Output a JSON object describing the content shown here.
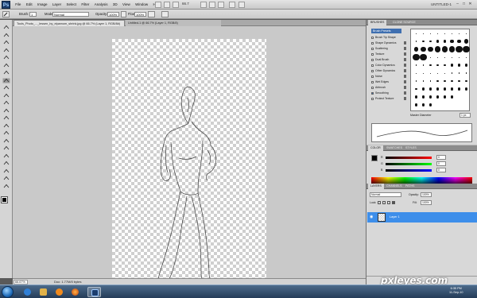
{
  "app": {
    "logo": "Ps",
    "menus": [
      "File",
      "Edit",
      "Image",
      "Layer",
      "Select",
      "Filter",
      "Analysis",
      "3D",
      "View",
      "Window",
      "Help"
    ],
    "zoom_menu": "66.7",
    "workspace": "UNTITLED-1",
    "window_controls": [
      "–",
      "□",
      "✕"
    ]
  },
  "options": {
    "brush_label": "Brush:",
    "brush_size": "1",
    "mode_label": "Mode:",
    "mode_value": "Normal",
    "opacity_label": "Opacity:",
    "opacity_value": "100%",
    "flow_label": "Flow:",
    "flow_value": "100%"
  },
  "document": {
    "tabs": [
      "Tools_Photo_..._lessen_by_elpamom_shrink.jpg @ 66.7% (Layer 1, RGB/8#)",
      "Untitled-1 @ 66.7% (Layer 1, RGB/8)"
    ],
    "zoom": "66.67%",
    "doc_info": "Doc: 1.77M/0 bytes"
  },
  "brushes": {
    "tabs": [
      "BRUSHES",
      "CLONE SOURCE"
    ],
    "presets_label": "Brush Presets",
    "options": [
      {
        "label": "Brush Tip Shape",
        "checked": false
      },
      {
        "label": "Shape Dynamics",
        "checked": false
      },
      {
        "label": "Scattering",
        "checked": false
      },
      {
        "label": "Texture",
        "checked": false
      },
      {
        "label": "Dual Brush",
        "checked": false
      },
      {
        "label": "Color Dynamics",
        "checked": false
      },
      {
        "label": "Other Dynamics",
        "checked": false
      },
      {
        "label": "Noise",
        "checked": false
      },
      {
        "label": "Wet Edges",
        "checked": false
      },
      {
        "label": "Airbrush",
        "checked": false
      },
      {
        "label": "Smoothing",
        "checked": true
      },
      {
        "label": "Protect Texture",
        "checked": false
      }
    ],
    "master_diameter_label": "Master Diameter",
    "master_diameter_value": "1 px"
  },
  "color_panel": {
    "tabs": [
      "COLOR",
      "SWATCHES",
      "STYLES"
    ],
    "sliders": [
      {
        "letter": "R",
        "value": "0",
        "track": "#c00000"
      },
      {
        "letter": "G",
        "value": "0",
        "track": "#00a000"
      },
      {
        "letter": "B",
        "value": "0",
        "track": "#0000c0"
      }
    ]
  },
  "layers": {
    "tabs": [
      "LAYERS",
      "CHANNELS",
      "PATHS"
    ],
    "blend_mode": "Normal",
    "opacity_label": "Opacity:",
    "opacity_value": "100%",
    "lock_label": "Lock:",
    "fill_label": "Fill:",
    "fill_value": "100%",
    "layer_name": "Layer 1"
  },
  "watermark": "pxleyes.com",
  "taskbar": {
    "clock_time": "6:35 PM",
    "clock_date": "11-Sep-10"
  },
  "colors": {
    "selection": "#3d8eea",
    "panel": "#d8d8d8",
    "canvas_bg": "#c9c9c9"
  }
}
